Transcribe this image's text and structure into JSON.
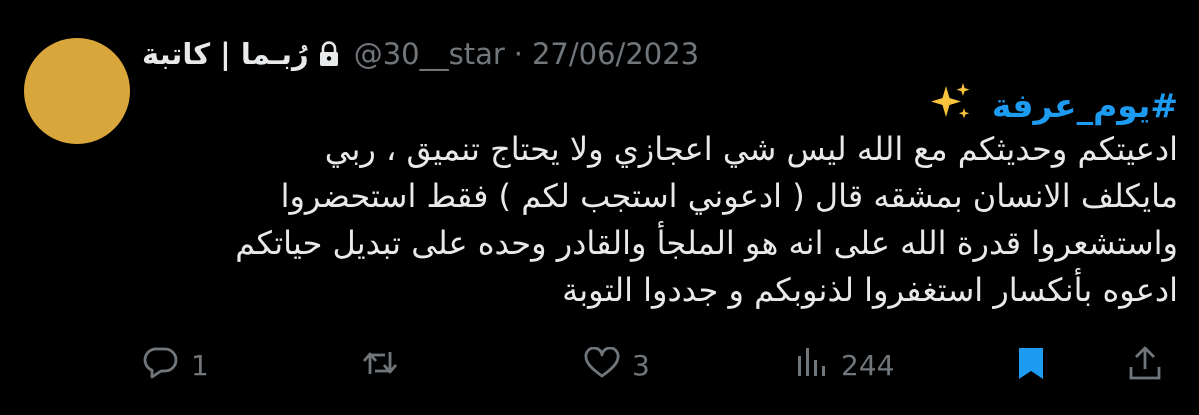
{
  "author": {
    "display_name": "رُبـما | كاتبة",
    "handle": "@30__star",
    "separator": "·",
    "date": "27/06/2023",
    "avatar_color": "#d8a63a"
  },
  "tweet": {
    "hashtag": "#يوم_عرفة",
    "sparkle_icon": "sparkles-icon",
    "lines": [
      "ادعيتكم وحديثكم مع الله ليس شي اعجازي ولا يحتاج تنميق ، ربي",
      "مايكلف الانسان بمشقه قال ( ادعوني استجب لكم ) فقط استحضروا",
      "واستشعروا قدرة الله على انه هو الملجأ والقادر وحده على تبديل حياتكم",
      "ادعوه بأنكسار استغفروا لذنوبكم و جددوا التوبة"
    ]
  },
  "actions": {
    "reply_count": "1",
    "retweet_count": "",
    "like_count": "3",
    "views_count": "244",
    "bookmark_color": "#1d9bf0",
    "icons": [
      "reply-icon",
      "retweet-icon",
      "like-icon",
      "views-icon",
      "bookmark-icon",
      "share-icon"
    ]
  },
  "colors": {
    "background": "#000000",
    "text": "#e7e9ea",
    "muted": "#71767b",
    "accent": "#1d9bf0"
  }
}
